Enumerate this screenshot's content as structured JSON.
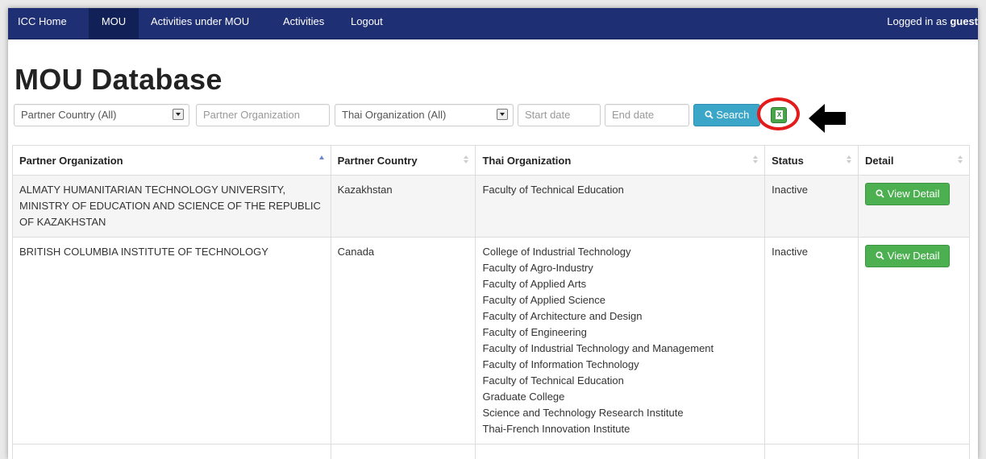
{
  "nav": {
    "items": [
      {
        "label": "ICC Home"
      },
      {
        "label": "MOU"
      },
      {
        "label": "Activities under MOU"
      },
      {
        "label": "Activities"
      },
      {
        "label": "Logout"
      }
    ],
    "logged_in_prefix": "Logged in as ",
    "user": "guest"
  },
  "title": "MOU Database",
  "filters": {
    "partner_country": "Partner Country (All)",
    "partner_org_placeholder": "Partner Organization",
    "thai_org": "Thai Organization (All)",
    "start_placeholder": "Start date",
    "end_placeholder": "End date",
    "search_label": "Search"
  },
  "table": {
    "headers": [
      "Partner Organization",
      "Partner Country",
      "Thai Organization",
      "Status",
      "Detail"
    ],
    "rows": [
      {
        "partner_org": "ALMATY HUMANITARIAN TECHNOLOGY UNIVERSITY, MINISTRY OF EDUCATION AND SCIENCE OF THE REPUBLIC OF KAZAKHSTAN",
        "country": "Kazakhstan",
        "thai_orgs": [
          "Faculty of Technical Education"
        ],
        "status": "Inactive",
        "detail_label": "View Detail"
      },
      {
        "partner_org": "BRITISH COLUMBIA INSTITUTE OF TECHNOLOGY",
        "country": "Canada",
        "thai_orgs": [
          "College of Industrial Technology",
          "Faculty of Agro-Industry",
          "Faculty of Applied Arts",
          "Faculty of Applied Science",
          "Faculty of Architecture and Design",
          "Faculty of Engineering",
          "Faculty of Industrial Technology and Management",
          "Faculty of Information Technology",
          "Faculty of Technical Education",
          "Graduate College",
          "Science and Technology Research Institute",
          "Thai-French Innovation Institute"
        ],
        "status": "Inactive",
        "detail_label": "View Detail"
      }
    ]
  },
  "colors": {
    "navbar": "#1f2f73",
    "search_button": "#3ba6c7",
    "view_detail_button": "#4caf50",
    "highlight_circle": "#e31b1b"
  },
  "icons": [
    "search-icon",
    "excel-export-icon",
    "sort-icon",
    "left-arrow-icon"
  ]
}
